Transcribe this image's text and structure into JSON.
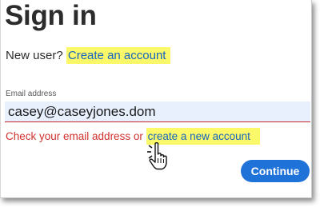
{
  "signin": {
    "title": "Sign in",
    "new_user_text": "New user?",
    "create_account_link": "Create an account",
    "email_label": "Email address",
    "email_value": "casey@caseyjones.dom",
    "error_text": "Check your email address or",
    "error_link": "create a new account",
    "continue_label": "Continue"
  },
  "colors": {
    "highlight": "#fbf86a",
    "link": "#1564c0",
    "error": "#d0312d",
    "button": "#1f73d8",
    "input_bg": "#e8f0fe"
  },
  "icons": {
    "cursor": "hand-pointer-icon"
  }
}
